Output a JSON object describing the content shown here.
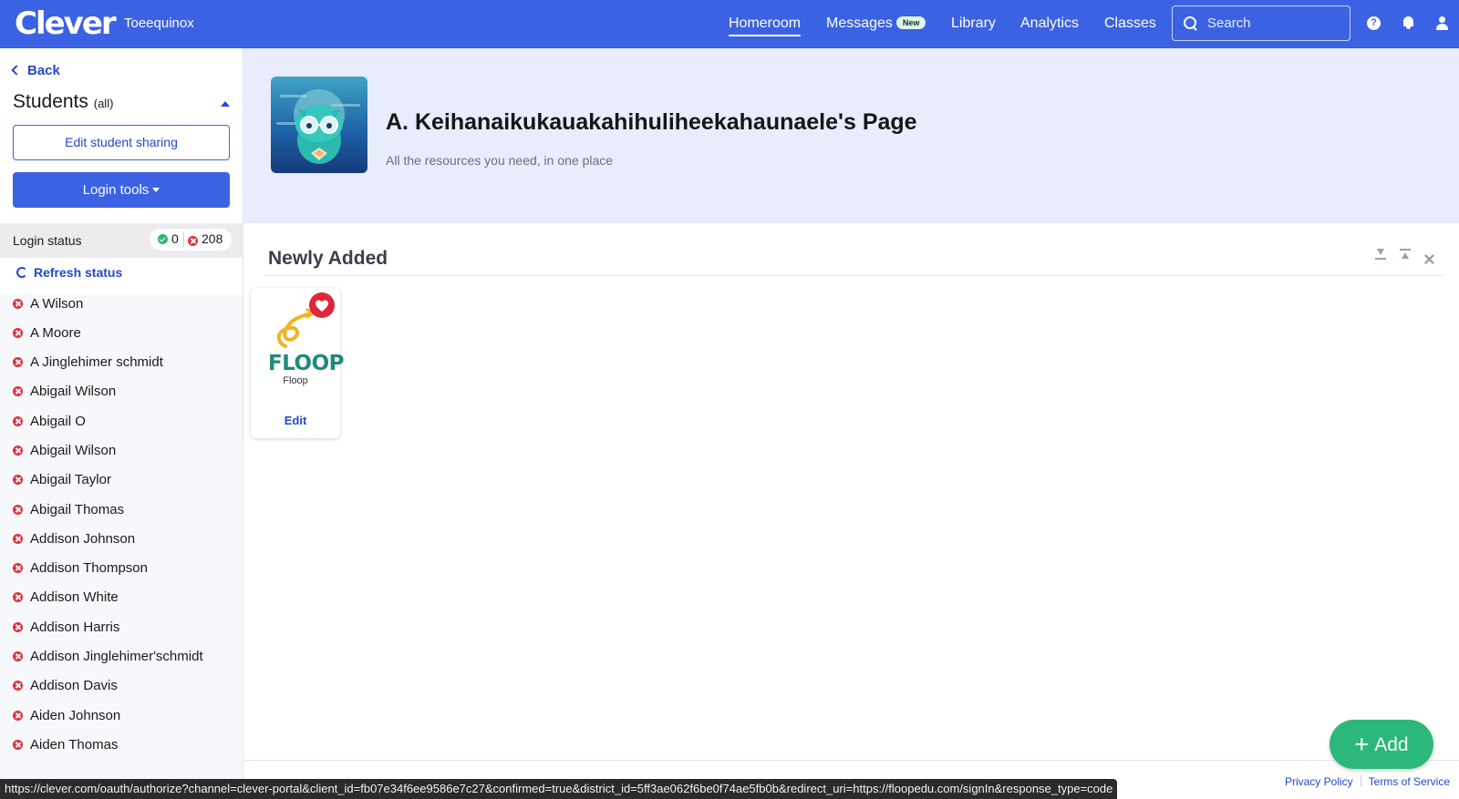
{
  "topbar": {
    "logo": "Clever",
    "district": "Toeequinox",
    "nav": [
      {
        "label": "Homeroom",
        "active": true
      },
      {
        "label": "Messages",
        "badge": "New"
      },
      {
        "label": "Library"
      },
      {
        "label": "Analytics"
      },
      {
        "label": "Classes"
      }
    ],
    "search_placeholder": "Search",
    "icons": [
      "help-icon",
      "bell-icon",
      "user-icon"
    ]
  },
  "sidebar": {
    "back": "Back",
    "students_title": "Students",
    "students_filter": "(all)",
    "edit_sharing": "Edit student sharing",
    "login_tools": "Login tools",
    "login_status_label": "Login status",
    "logged_in_count": "0",
    "not_logged_in_count": "208",
    "refresh": "Refresh status",
    "students": [
      "A Wilson",
      "A Moore",
      "A Jinglehimer schmidt",
      "Abigail Wilson",
      "Abigail O",
      "Abigail Wilson",
      "Abigail Taylor",
      "Abigail Thomas",
      "Addison Johnson",
      "Addison Thompson",
      "Addison White",
      "Addison Harris",
      "Addison Jinglehimer'schmidt",
      "Addison Davis",
      "Aiden Johnson",
      "Aiden Thomas"
    ]
  },
  "banner": {
    "title": "A. Keihanaikukauakahihuliheekahaunaele's Page",
    "subtitle": "All the resources you need, in one place"
  },
  "section": {
    "title": "Newly Added",
    "apps": [
      {
        "logo_text": "FLOOP",
        "name": "Floop",
        "edit": "Edit",
        "favorite": true
      }
    ]
  },
  "add_button": "Add",
  "footer": {
    "privacy": "Privacy Policy",
    "terms": "Terms of Service"
  },
  "status_url": "https://clever.com/oauth/authorize?channel=clever-portal&client_id=fb07e34f6ee9586e7c27&confirmed=true&district_id=5ff3ae062f6be0f74ae5fb0b&redirect_uri=https://floopedu.com/signIn&response_type=code",
  "colors": {
    "brand": "#3b62e3",
    "banner_bg": "#e8ecfc",
    "error": "#e0313f",
    "success": "#2bb673",
    "add_button": "#2bb87a"
  }
}
